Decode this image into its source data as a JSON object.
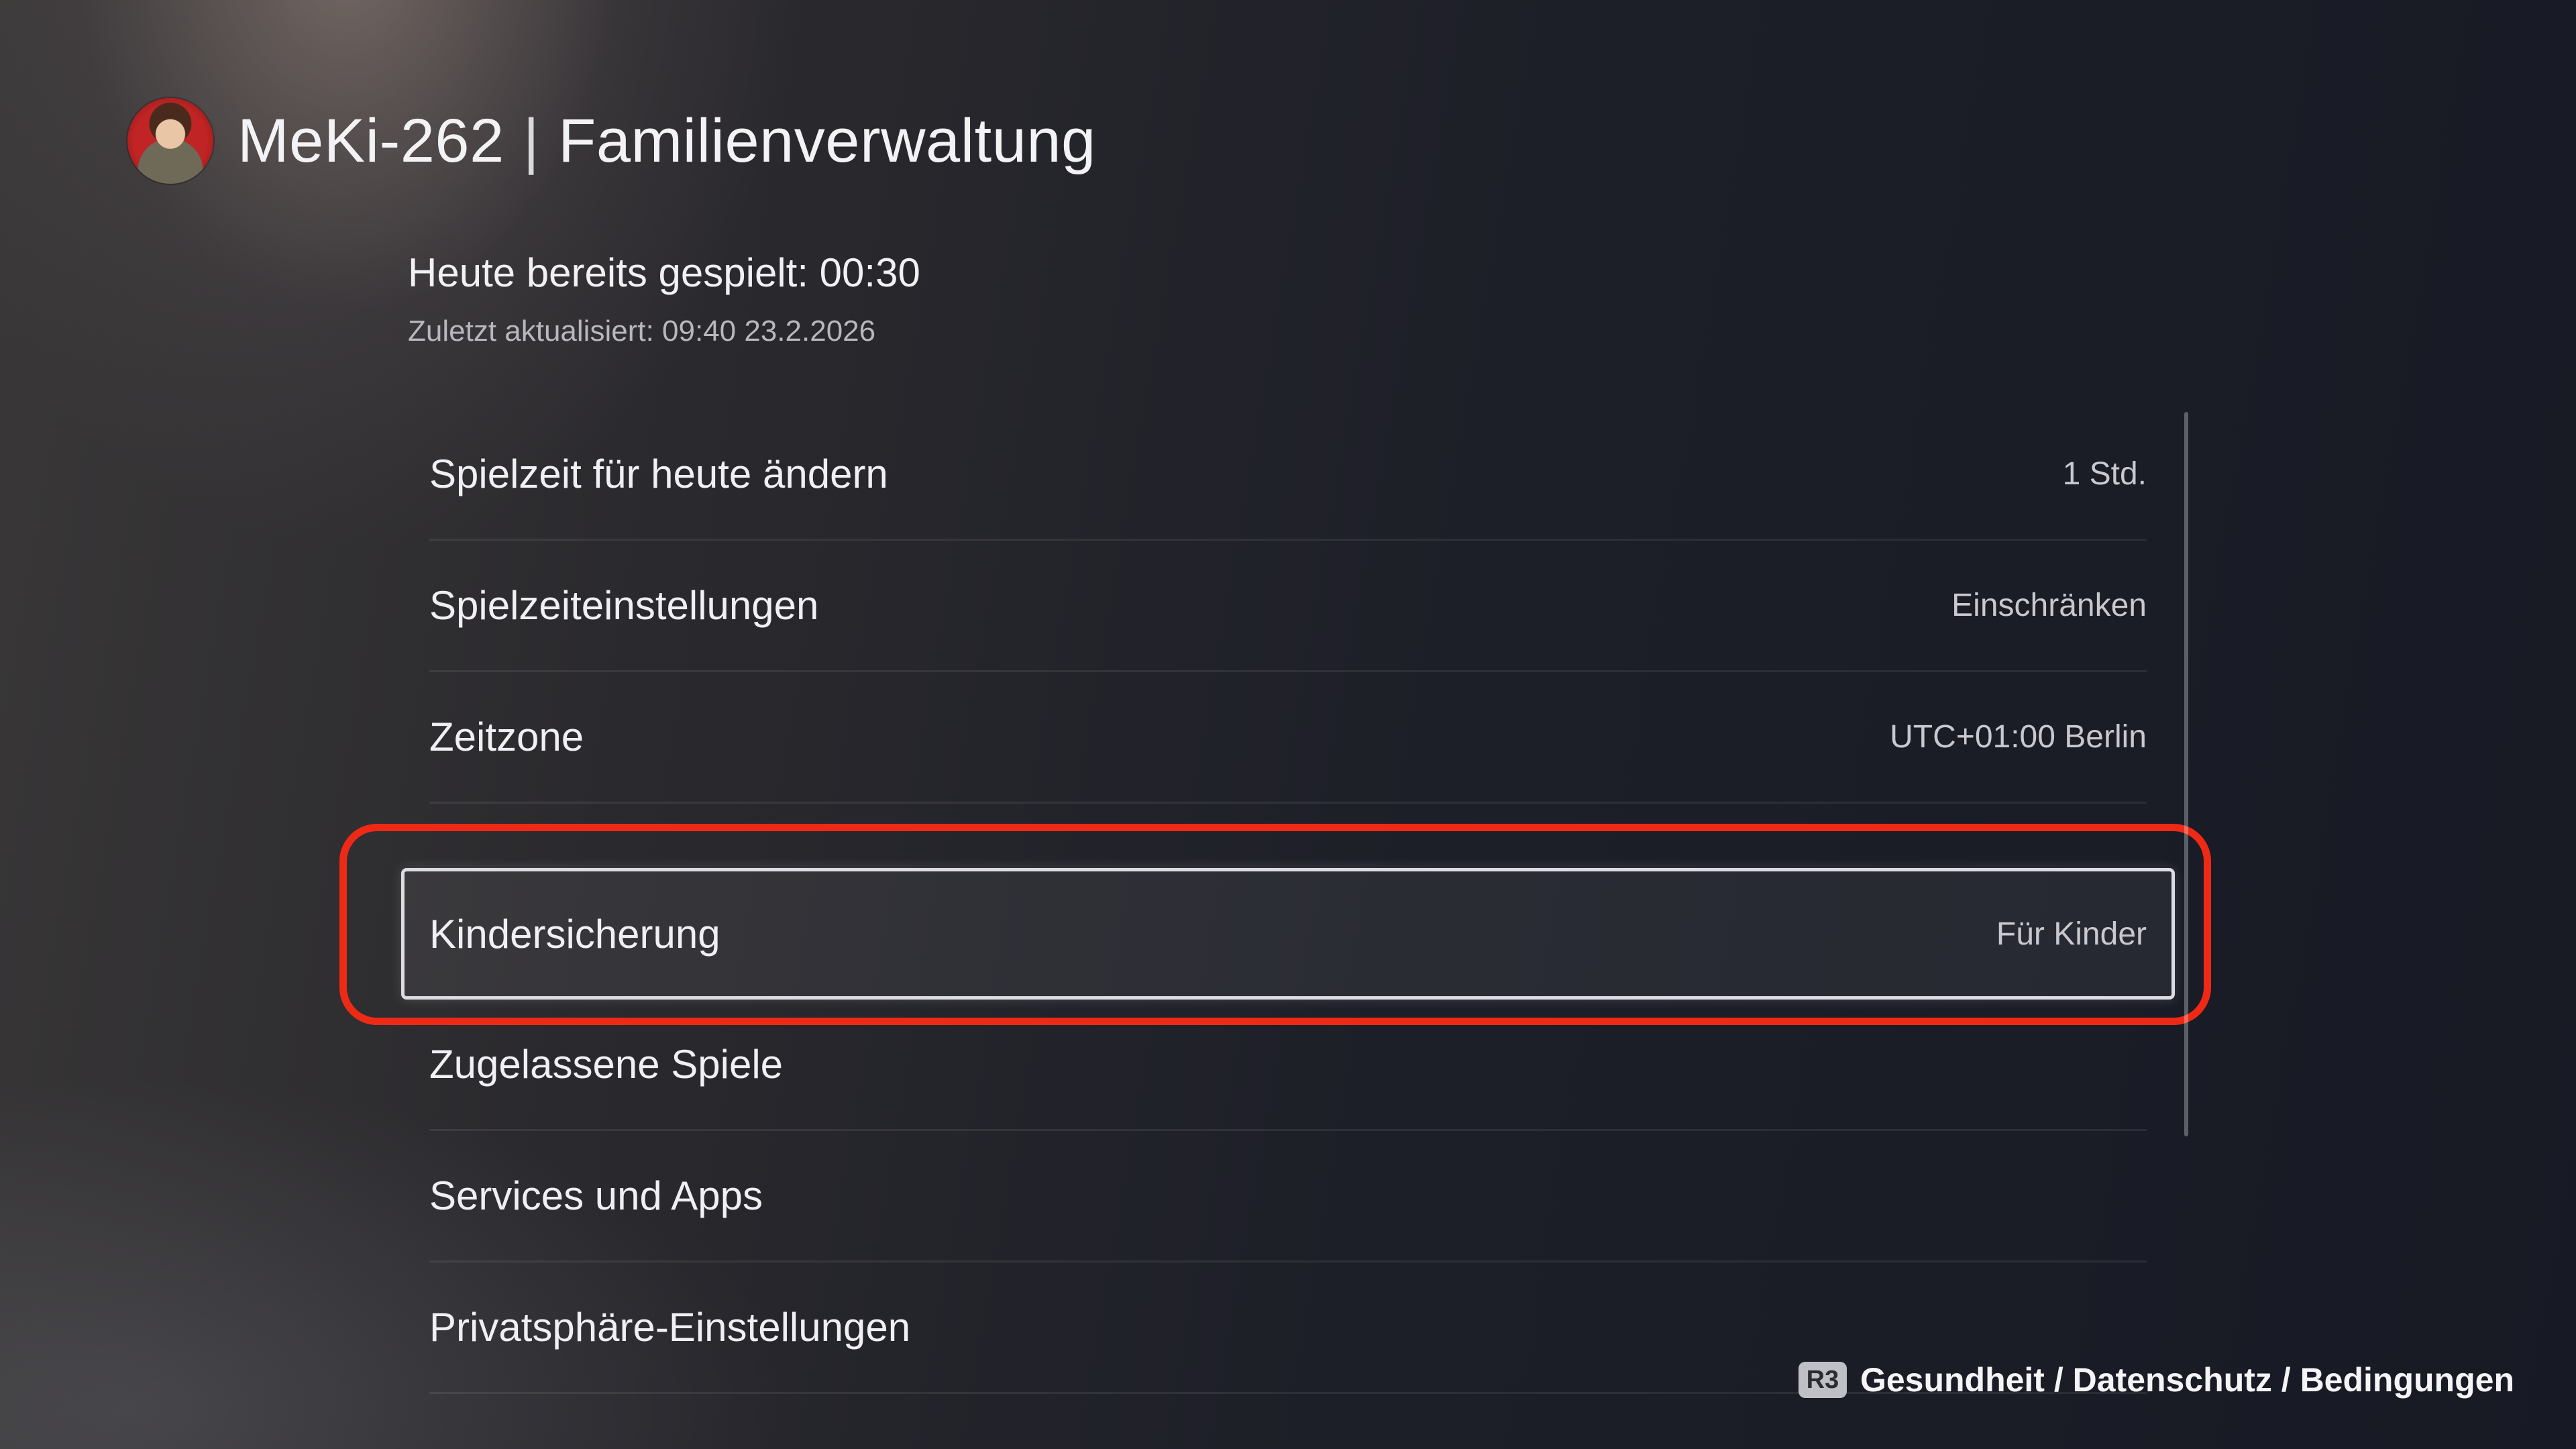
{
  "header": {
    "username": "MeKi-262",
    "separator": "|",
    "section": "Familienverwaltung"
  },
  "status": {
    "played_today": "Heute bereits gespielt: 00:30",
    "last_updated": "Zuletzt aktualisiert: 09:40 23.2.2026"
  },
  "menu": {
    "items": [
      {
        "label": "Spielzeit für heute ändern",
        "value": "1 Std."
      },
      {
        "label": "Spielzeiteinstellungen",
        "value": "Einschränken"
      },
      {
        "label": "Zeitzone",
        "value": "UTC+01:00 Berlin"
      },
      {
        "label": "Kindersicherung",
        "value": "Für Kinder",
        "focused": true
      },
      {
        "label": "Zugelassene Spiele",
        "value": ""
      },
      {
        "label": "Services und Apps",
        "value": ""
      },
      {
        "label": "Privatsphäre-Einstellungen",
        "value": ""
      }
    ]
  },
  "footer": {
    "button": "R3",
    "text": "Gesundheit / Datenschutz / Bedingungen"
  },
  "colors": {
    "highlight": "#ee2a16",
    "focus_border": "#dcdce2"
  }
}
